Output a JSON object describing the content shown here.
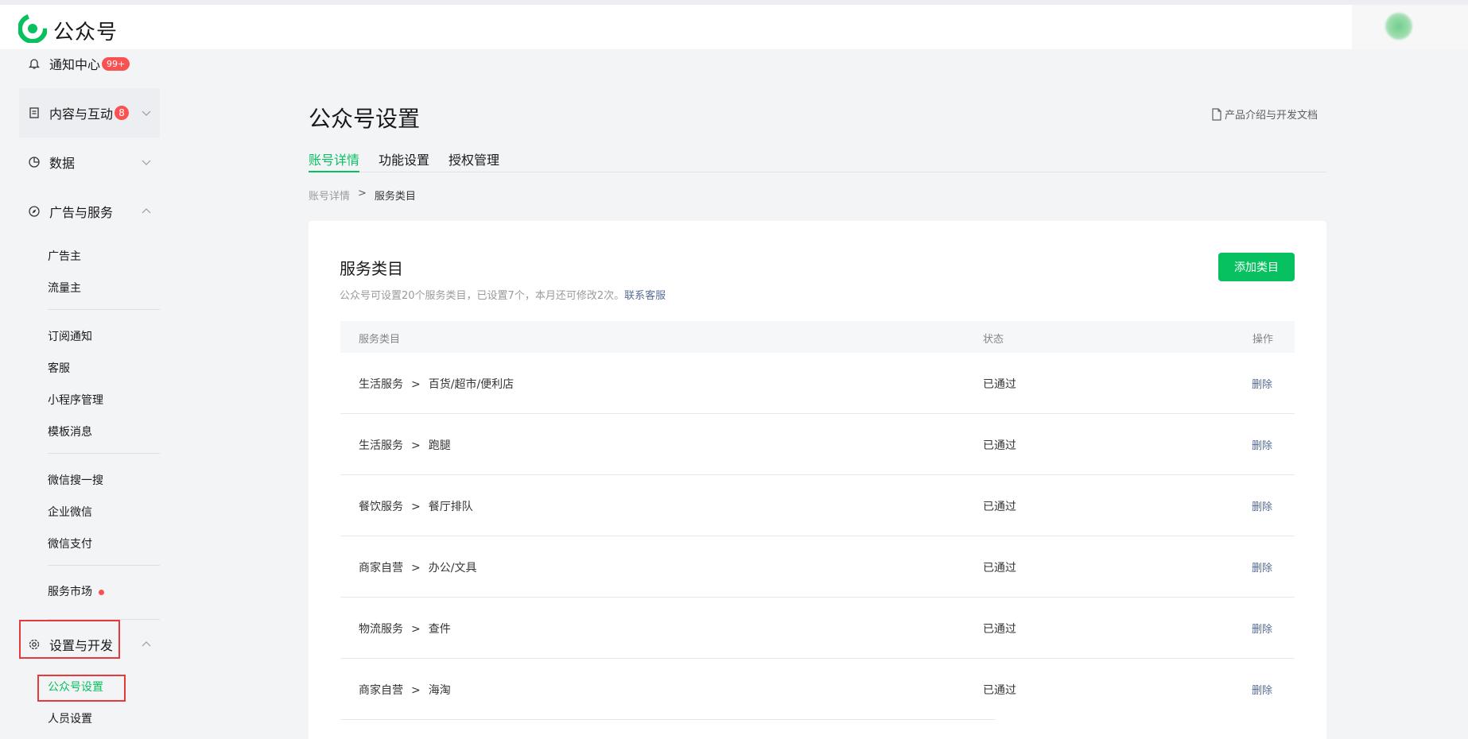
{
  "app": {
    "brand": "公众号"
  },
  "sidebar": {
    "notify": {
      "label": "通知中心",
      "badge": "99+"
    },
    "content": {
      "label": "内容与互动",
      "badge": "8"
    },
    "data": {
      "label": "数据"
    },
    "ads": {
      "label": "广告与服务"
    },
    "ads_items": [
      "广告主",
      "流量主",
      "订阅通知",
      "客服",
      "小程序管理",
      "模板消息",
      "微信搜一搜",
      "企业微信",
      "微信支付",
      "服务市场"
    ],
    "settings": {
      "label": "设置与开发"
    },
    "settings_items": [
      "公众号设置",
      "人员设置"
    ]
  },
  "page": {
    "title": "公众号设置",
    "doc_link": "产品介绍与开发文档",
    "tabs": [
      "账号详情",
      "功能设置",
      "授权管理"
    ],
    "breadcrumb": {
      "prev": "账号详情",
      "sep": ">",
      "current": "服务类目"
    }
  },
  "card": {
    "title": "服务类目",
    "desc": "公众号可设置20个服务类目，已设置7个，本月还可修改2次。",
    "desc_link": "联系客服",
    "add_button": "添加类目",
    "columns": [
      "服务类目",
      "状态",
      "操作"
    ],
    "rows": [
      {
        "parent": "生活服务",
        "sep": ">",
        "child": "百货/超市/便利店",
        "status": "已通过",
        "action": "删除"
      },
      {
        "parent": "生活服务",
        "sep": ">",
        "child": "跑腿",
        "status": "已通过",
        "action": "删除"
      },
      {
        "parent": "餐饮服务",
        "sep": ">",
        "child": "餐厅排队",
        "status": "已通过",
        "action": "删除"
      },
      {
        "parent": "商家自营",
        "sep": ">",
        "child": "办公/文具",
        "status": "已通过",
        "action": "删除"
      },
      {
        "parent": "物流服务",
        "sep": ">",
        "child": "查件",
        "status": "已通过",
        "action": "删除"
      },
      {
        "parent": "商家自营",
        "sep": ">",
        "child": "海淘",
        "status": "已通过",
        "action": "删除"
      }
    ]
  },
  "colors": {
    "accent": "#07c160",
    "link": "#576b95",
    "badge": "#fa5151",
    "highlight": "#e5393b"
  }
}
